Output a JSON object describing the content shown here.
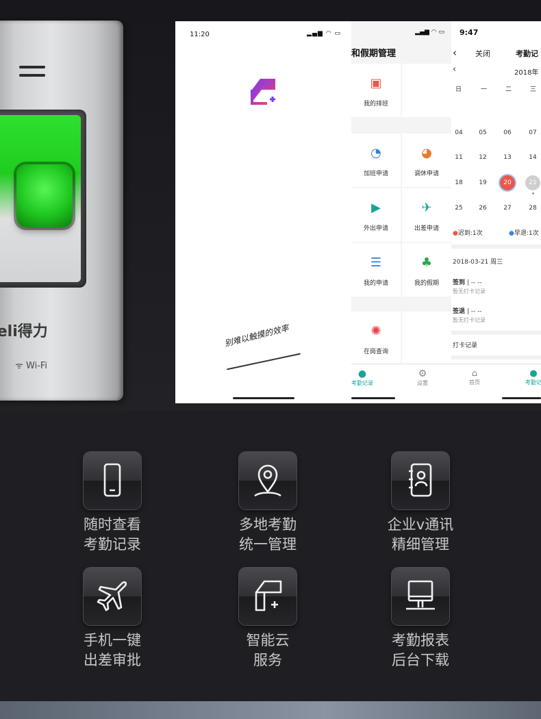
{
  "device": {
    "brand": "deli得力",
    "wifi_label": "Wi-Fi"
  },
  "phone1": {
    "time": "11:20",
    "slogan": "别难以触摸的效率"
  },
  "phone2": {
    "title": "和假期管理",
    "items": [
      "我的排班",
      "加班申请",
      "调休申请",
      "外出申请",
      "出差申请",
      "我的申请",
      "我的假期",
      "在岗查询"
    ],
    "tabs": [
      "考勤记录",
      "设置"
    ]
  },
  "phone3": {
    "time": "9:47",
    "back_label": "关闭",
    "title": "考勤记",
    "month": "2018年",
    "weekdays": [
      "日",
      "一",
      "二",
      "三"
    ],
    "weeks": [
      [
        "04",
        "05",
        "06",
        "07"
      ],
      [
        "11",
        "12",
        "13",
        "14"
      ],
      [
        "18",
        "19",
        "20",
        "21"
      ],
      [
        "25",
        "26",
        "27",
        "28"
      ]
    ],
    "legend_late": "迟到:1次",
    "legend_early": "早退:1次",
    "date_row": "2018-03-21 周三",
    "checkin_label": "签到",
    "checkout_label": "签退",
    "time_placeholder": "-- --",
    "no_record": "暂无打卡记录",
    "punch_records": "打卡记录",
    "tabs": [
      "首页",
      "考勤记"
    ]
  },
  "features": [
    {
      "icon": "phone-icon",
      "line1": "随时查看",
      "line2": "考勤记录"
    },
    {
      "icon": "location-pin-icon",
      "line1": "多地考勤",
      "line2": "统一管理"
    },
    {
      "icon": "contact-book-icon",
      "line1": "企业v通讯",
      "line2": "精细管理"
    },
    {
      "icon": "airplane-icon",
      "line1": "手机一键",
      "line2": "出差审批"
    },
    {
      "icon": "cloud-service-icon",
      "line1": "智能云",
      "line2": "服务"
    },
    {
      "icon": "monitor-icon",
      "line1": "考勤报表",
      "line2": "后台下载"
    }
  ],
  "colors": {
    "accent_teal": "#1aa39a",
    "late_red": "#e8584e",
    "early_blue": "#3f84e8",
    "logo_gradient_start": "#7a3cf0",
    "logo_gradient_end": "#e8407a"
  }
}
